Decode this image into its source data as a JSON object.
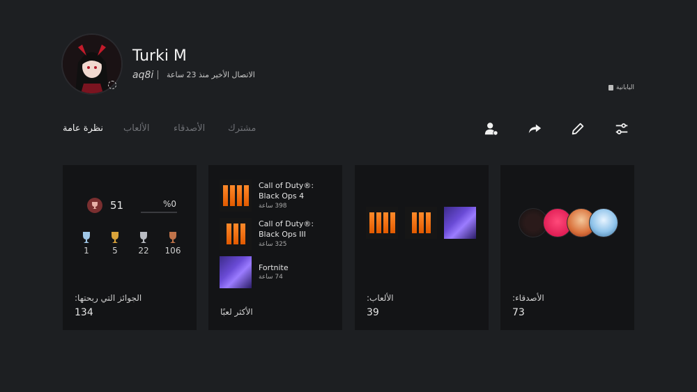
{
  "profile": {
    "name": "Turki M",
    "handle": "aq8i",
    "last_seen": "الاتصال الأخير منذ 23 ساعة",
    "language": "اليابانية"
  },
  "tabs": [
    {
      "label": "نظرة عامة",
      "active": true
    },
    {
      "label": "الألعاب",
      "active": false
    },
    {
      "label": "الأصدقاء",
      "active": false
    },
    {
      "label": "مشترك",
      "active": false
    }
  ],
  "toolbar": {
    "icons": [
      "add-friend-icon",
      "share-icon",
      "edit-icon",
      "filter-icon"
    ]
  },
  "trophies": {
    "level": "51",
    "progress_label": "%0",
    "progress": 0,
    "counts": [
      {
        "type": "platinum",
        "value": "1"
      },
      {
        "type": "gold",
        "value": "5"
      },
      {
        "type": "silver",
        "value": "22"
      },
      {
        "type": "bronze",
        "value": "106"
      }
    ],
    "caption": "الجوائز التي ربحتها:",
    "total": "134"
  },
  "most_played": {
    "items": [
      {
        "title": "Call of Duty®: Black Ops 4",
        "hours": "398 ساعة"
      },
      {
        "title": "Call of Duty®: Black Ops III",
        "hours": "325 ساعة"
      },
      {
        "title": "Fortnite",
        "hours": "74 ساعة"
      }
    ],
    "caption": "الأكثر لعبًا"
  },
  "games": {
    "caption": "الألعاب:",
    "total": "39"
  },
  "friends": {
    "caption": "الأصدقاء:",
    "total": "73"
  },
  "colors": {
    "background": "#1d1f22",
    "card": "#131416",
    "accent_orange": "#e25a00"
  }
}
